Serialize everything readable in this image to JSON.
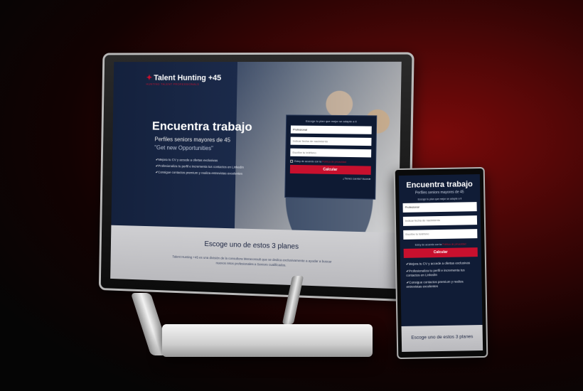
{
  "desktop": {
    "logo": "Talent Hunting +45",
    "logo_subtitle": "HUNTING TALENT PROFESSIONALS",
    "hero": {
      "title": "Encuentra trabajo",
      "subtitle": "Perfiles seniors mayores de 45",
      "quote": "\"Get new Opportunities\"",
      "benefits": [
        "Mejora tu CV y accede a ofertas exclusivas",
        "Profesionaliza tu perfil e incrementa tus contactos en LinkedIn",
        "Consigue contactos premium y realiza entrevistas excelentes"
      ]
    },
    "form": {
      "title": "Escoge tu plan que mejor se adapte a ti",
      "select_value": "Profesional",
      "birthdate_placeholder": "Indicar fecha de nacimiento",
      "phone_placeholder": "Escribe tu teléfono",
      "privacy_text": "Estoy de acuerdo con la",
      "privacy_link": "Política de privacidad",
      "submit_label": "Calcular",
      "login_text": "¿Tienes cuenta? Accede"
    },
    "plans": {
      "title": "Escoge uno de estos 3 planes",
      "description": "Talent Hunting +45 es una división de la consultora Meraconsult que se dedica exclusivamente a ayudar a buscar nuevos retos profesionales a Seniors cualificados."
    }
  },
  "mobile": {
    "title": "Encuentra trabajo",
    "subtitle": "Perfiles seniors mayores de 45",
    "form": {
      "title": "Escoge tu plan que mejor se adapte a ti",
      "select_value": "Profesional",
      "birthdate_placeholder": "Indicar fecha de nacimiento",
      "phone_placeholder": "Escribe tu teléfono",
      "privacy_text": "Estoy de acuerdo con la",
      "privacy_link": "Política de privacidad",
      "submit_label": "Calcular"
    },
    "benefits": [
      "Mejora tu CV y accede a ofertas exclusivas",
      "Profesionaliza tu perfil e incrementa tus contactos en LinkedIn",
      "Consigue contactos premium y realiza entrevistas excelentes"
    ],
    "plans_title": "Escoge uno de estos 3 planes"
  },
  "colors": {
    "brand_red": "#c8102e",
    "navy": "#0f1b33"
  }
}
